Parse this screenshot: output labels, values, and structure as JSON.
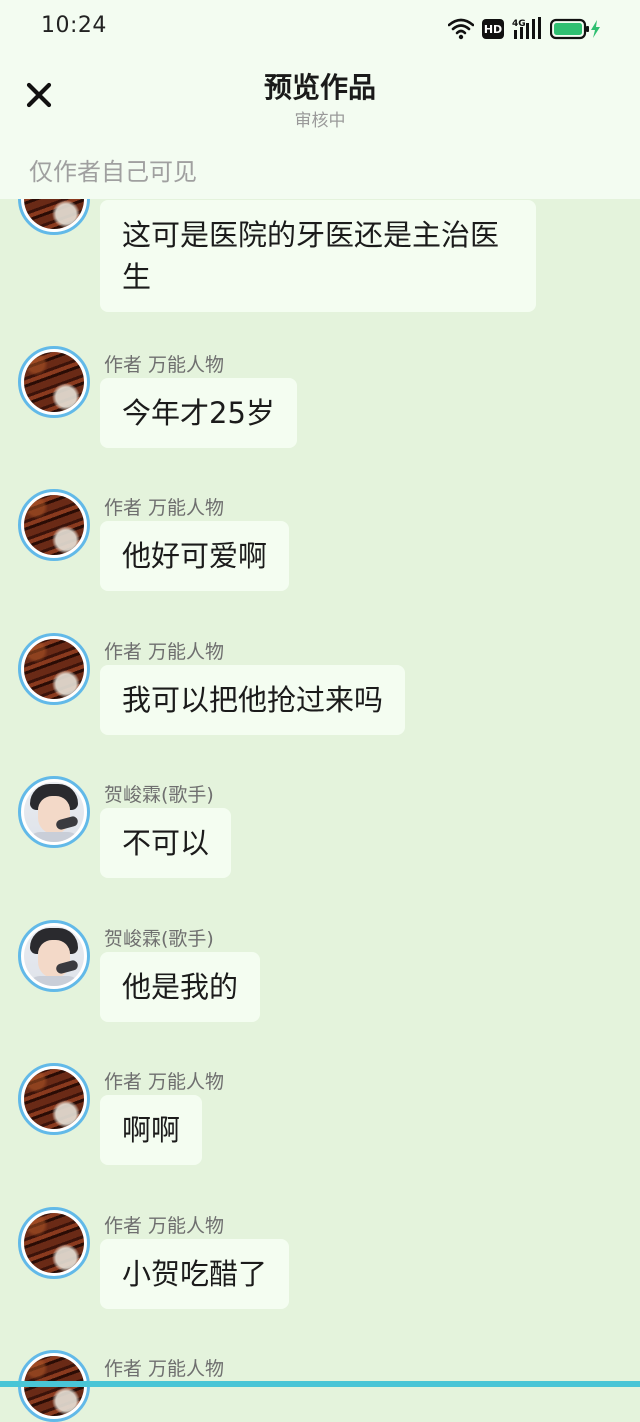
{
  "status_bar": {
    "time": "10:24",
    "hd_label": "HD",
    "network_label": "4G",
    "icons": [
      "wifi-icon",
      "hd-icon",
      "signal-4g-icon",
      "battery-charging-icon"
    ],
    "battery_color": "#2fbf71"
  },
  "nav": {
    "title": "预览作品",
    "subtitle": "审核中",
    "close_icon": "close-icon"
  },
  "visibility_note": "仅作者自己可见",
  "colors": {
    "background": "#e4f3dc",
    "header": "#f3fcf1",
    "bubble": "#f4fdf1",
    "avatar_ring": "#62b9e8",
    "bottom_bar": "#49c5d6"
  },
  "messages": [
    {
      "author": "",
      "avatar": "food-avatar",
      "text": "这可是医院的牙医还是主治医生"
    },
    {
      "author": "作者 万能人物",
      "avatar": "food-avatar",
      "text": "今年才25岁"
    },
    {
      "author": "作者 万能人物",
      "avatar": "food-avatar",
      "text": "他好可爱啊"
    },
    {
      "author": "作者 万能人物",
      "avatar": "food-avatar",
      "text": "我可以把他抢过来吗"
    },
    {
      "author": "贺峻霖(歌手)",
      "avatar": "singer-avatar",
      "text": "不可以"
    },
    {
      "author": "贺峻霖(歌手)",
      "avatar": "singer-avatar",
      "text": "他是我的"
    },
    {
      "author": "作者 万能人物",
      "avatar": "food-avatar",
      "text": "啊啊"
    },
    {
      "author": "作者 万能人物",
      "avatar": "food-avatar",
      "text": "小贺吃醋了"
    },
    {
      "author": "作者 万能人物",
      "avatar": "food-avatar",
      "text": ""
    }
  ]
}
